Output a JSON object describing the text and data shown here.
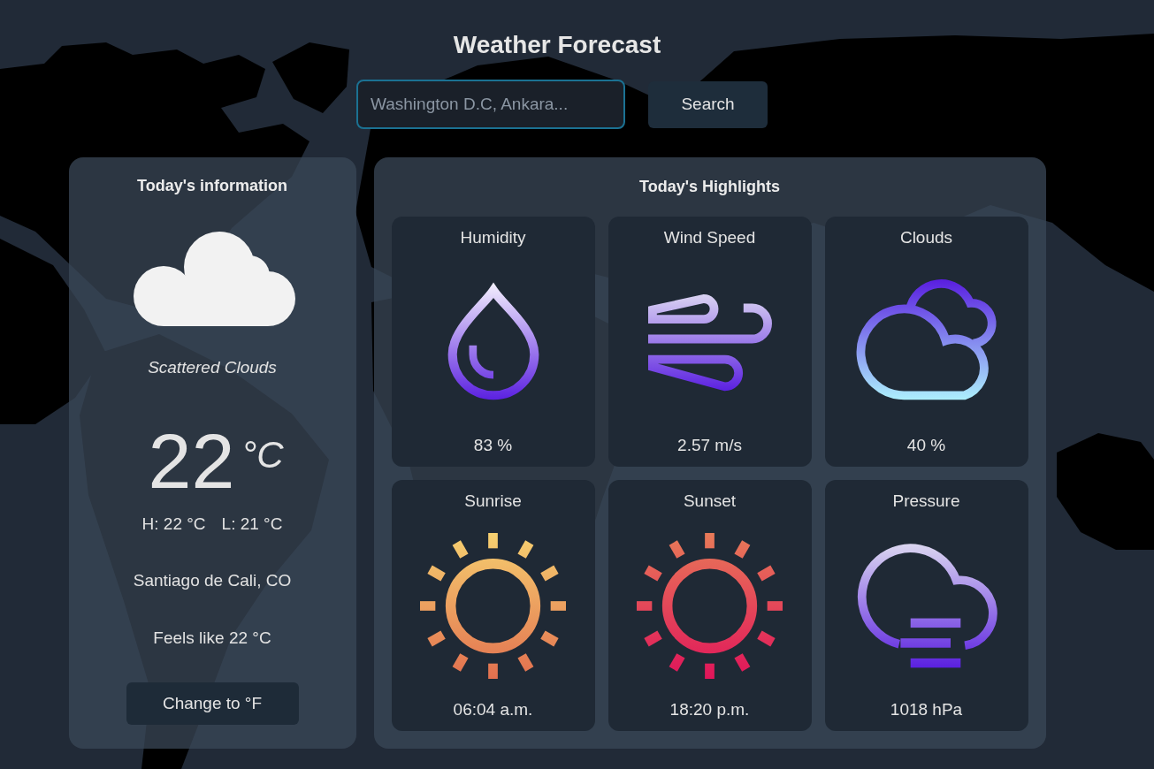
{
  "title": "Weather Forecast",
  "search": {
    "placeholder": "Washington D.C, Ankara...",
    "button": "Search",
    "focused": true
  },
  "today": {
    "title": "Today's information",
    "condition": "Scattered Clouds",
    "temperature": "22",
    "unit": "°C",
    "high": "H: 22 °C",
    "low": "L: 21 °C",
    "location": "Santiago de Cali, CO",
    "feels_like": "Feels like 22 °C",
    "toggle_button": "Change to °F"
  },
  "highlights": {
    "title": "Today's Highlights",
    "cards": [
      {
        "kind": "humidity",
        "label": "Humidity",
        "value": "83 %"
      },
      {
        "kind": "wind",
        "label": "Wind Speed",
        "value": "2.57 m/s"
      },
      {
        "kind": "clouds",
        "label": "Clouds",
        "value": "40 %"
      },
      {
        "kind": "sunrise",
        "label": "Sunrise",
        "value": "06:04 a.m."
      },
      {
        "kind": "sunset",
        "label": "Sunset",
        "value": "18:20 p.m."
      },
      {
        "kind": "pressure",
        "label": "Pressure",
        "value": "1018 hPa"
      }
    ]
  }
}
